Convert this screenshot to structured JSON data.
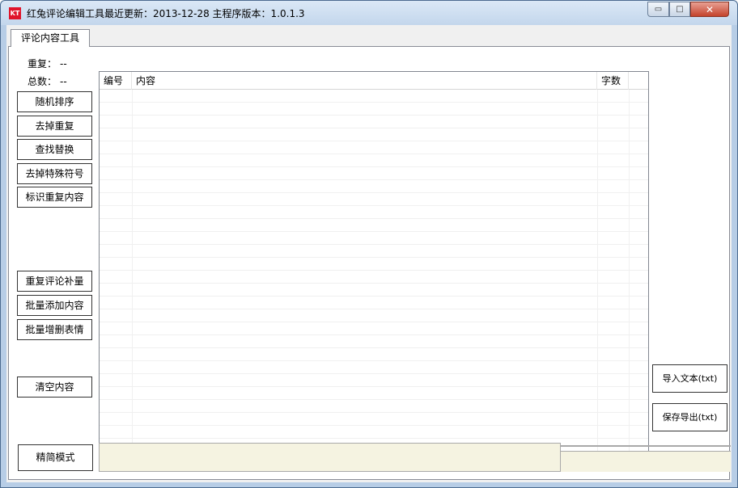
{
  "window": {
    "icon_text": "KT",
    "title": "红兔评论编辑工具最近更新：2013-12-28  主程序版本：1.0.1.3",
    "controls": {
      "minimize": "▭",
      "maximize": "□",
      "close": "✕"
    }
  },
  "tabs": [
    {
      "label": "评论内容工具",
      "selected": true
    }
  ],
  "stats": {
    "repeat_label": "重复：",
    "repeat_value": "--",
    "total_label": "总数：",
    "total_value": "--"
  },
  "left_buttons": {
    "random_sort": "随机排序",
    "remove_duplicates": "去掉重复",
    "find_replace": "查找替换",
    "remove_special_symbols": "去掉特殊符号",
    "mark_duplicates": "标识重复内容",
    "repeat_comment_fill": "重复评论补量",
    "batch_add_content": "批量添加内容",
    "batch_edit_emoji": "批量增删表情",
    "clear_content": "清空内容",
    "simple_mode": "精简模式"
  },
  "table": {
    "columns": [
      "编号",
      "内容",
      "字数"
    ],
    "rows": []
  },
  "right_buttons": {
    "import_text": "导入文本(txt)",
    "save_export": "保存导出(txt)"
  },
  "colors": {
    "titlebar": "#c3d6ec",
    "status_box": "#f5f3e1",
    "close_button": "#c4432c",
    "app_icon": "#e0142a"
  }
}
